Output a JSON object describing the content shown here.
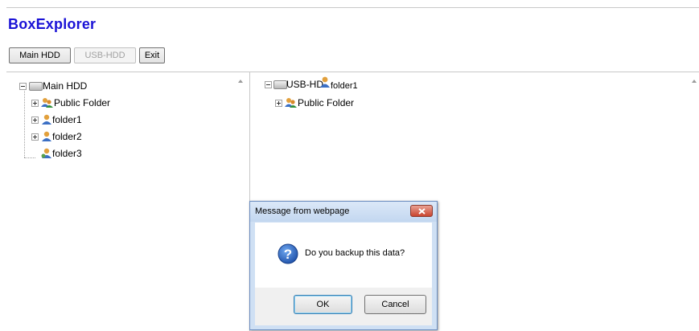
{
  "app": {
    "title": "BoxExplorer"
  },
  "toolbar": {
    "main_hdd_label": "Main HDD",
    "usb_hdd_label": "USB-HDD",
    "exit_label": "Exit"
  },
  "left_tree": {
    "root_label": "Main HDD",
    "items": [
      {
        "label": "Public Folder",
        "expandable": true
      },
      {
        "label": "folder1",
        "expandable": true
      },
      {
        "label": "folder2",
        "expandable": true
      },
      {
        "label": "folder3",
        "expandable": false
      }
    ]
  },
  "right_tree": {
    "root_label": "USB-HD",
    "root_suffix": "folder1",
    "items": [
      {
        "label": "Public Folder",
        "expandable": true
      }
    ]
  },
  "dialog": {
    "title": "Message from webpage",
    "message": "Do you backup this data?",
    "ok_label": "OK",
    "cancel_label": "Cancel",
    "icon": "question-icon"
  },
  "colors": {
    "title_blue": "#1a12d6",
    "dialog_frame": "#cfe0f4",
    "close_red": "#c9442f"
  }
}
